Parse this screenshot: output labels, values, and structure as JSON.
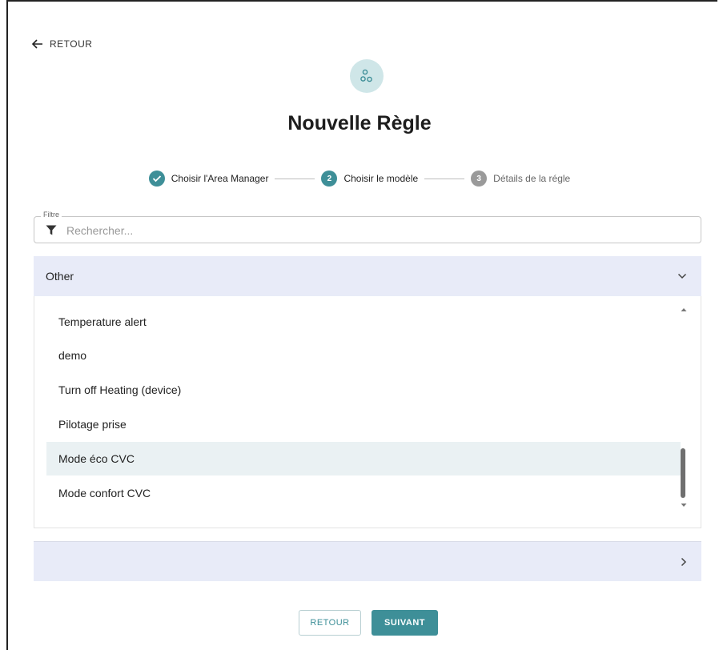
{
  "header": {
    "back_label": "RETOUR",
    "title": "Nouvelle Règle"
  },
  "stepper": {
    "steps": [
      {
        "number": "",
        "label": "Choisir l'Area Manager",
        "state": "done"
      },
      {
        "number": "2",
        "label": "Choisir le modèle",
        "state": "active"
      },
      {
        "number": "3",
        "label": "Détails de la régle",
        "state": "inactive"
      }
    ]
  },
  "filter": {
    "legend": "Filtre",
    "placeholder": "Rechercher...",
    "value": ""
  },
  "panels": {
    "other": {
      "title": "Other",
      "expanded": true,
      "items": [
        {
          "label": "Temperature alert",
          "selected": false
        },
        {
          "label": "demo",
          "selected": false
        },
        {
          "label": "Turn off Heating (device)",
          "selected": false
        },
        {
          "label": "Pilotage prise",
          "selected": false
        },
        {
          "label": "Mode éco CVC",
          "selected": true
        },
        {
          "label": "Mode confort CVC",
          "selected": false
        }
      ]
    },
    "second": {
      "title": "",
      "expanded": false
    }
  },
  "footer": {
    "back_button": "RETOUR",
    "next_button": "SUIVANT"
  },
  "colors": {
    "accent": "#3e8f98",
    "panel_header_bg": "#e8ebf8",
    "selected_row_bg": "#eaf1f3",
    "icon_circle_bg": "#cfe6e8",
    "inactive_step": "#9a9a9a"
  }
}
